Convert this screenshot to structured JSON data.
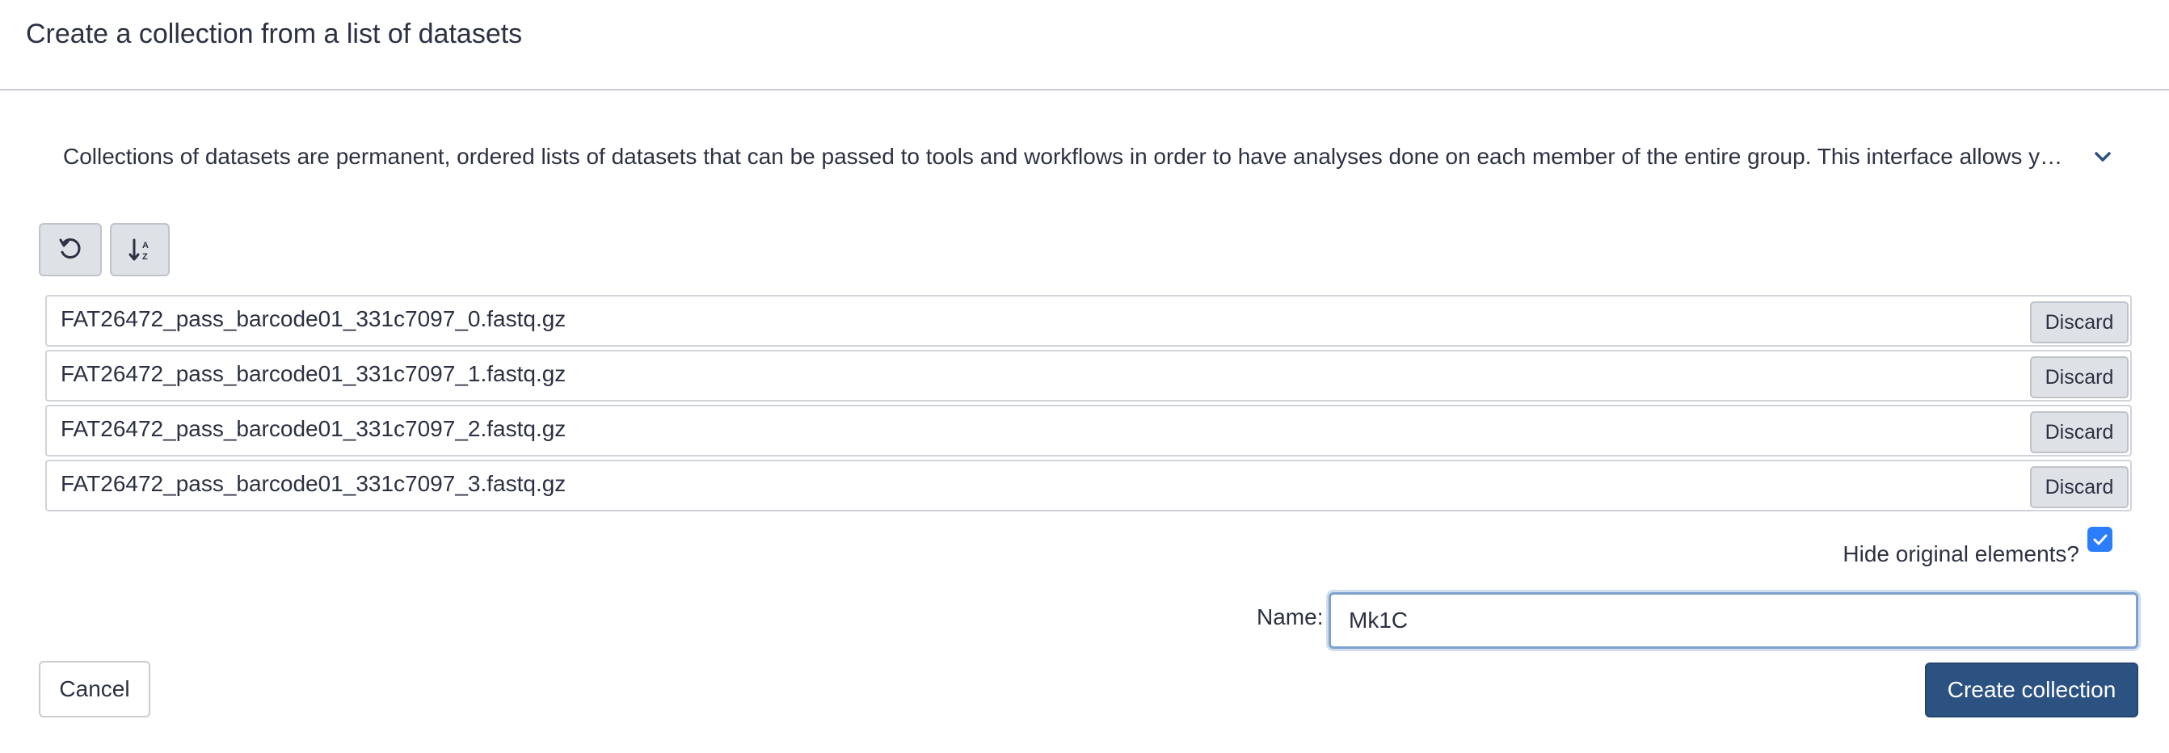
{
  "dialog": {
    "title": "Create a collection from a list of datasets"
  },
  "help": {
    "text": "Collections of datasets are permanent, ordered lists of datasets that can be passed to tools and workflows in order to have analyses done on each member of the entire group. This interface allows y…",
    "toggle_icon": "chevron-down-icon"
  },
  "toolbar": {
    "undo_icon": "undo-icon",
    "sort_icon": "sort-alpha-icon"
  },
  "elements": [
    {
      "name": "FAT26472_pass_barcode01_331c7097_0.fastq.gz",
      "discard_label": "Discard"
    },
    {
      "name": "FAT26472_pass_barcode01_331c7097_1.fastq.gz",
      "discard_label": "Discard"
    },
    {
      "name": "FAT26472_pass_barcode01_331c7097_2.fastq.gz",
      "discard_label": "Discard"
    },
    {
      "name": "FAT26472_pass_barcode01_331c7097_3.fastq.gz",
      "discard_label": "Discard"
    }
  ],
  "options": {
    "hide_original_label": "Hide original elements?",
    "hide_original_checked": true
  },
  "name_field": {
    "label": "Name:",
    "value": "Mk1C"
  },
  "footer": {
    "cancel_label": "Cancel",
    "create_label": "Create collection"
  },
  "colors": {
    "primary": "#2c5282",
    "checkbox": "#2a7dfc",
    "text": "#2c3143"
  }
}
